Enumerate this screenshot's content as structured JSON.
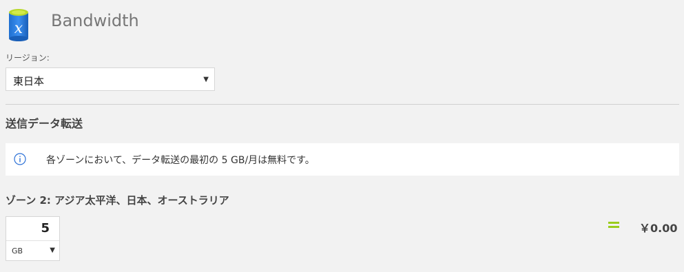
{
  "header": {
    "icon": "azure-bandwidth-icon",
    "title": "Bandwidth"
  },
  "region": {
    "label": "リージョン:",
    "selected": "東日本"
  },
  "section": {
    "title": "送信データ転送"
  },
  "info": {
    "icon": "info-icon",
    "text": "各ゾーンにおいて、データ転送の最初の 5 GB/月は無料です。"
  },
  "zone": {
    "title": "ゾーン 2: アジア太平洋、日本、オーストラリア",
    "quantity": "5",
    "unit": "GB",
    "equals_color": "#9acd1c",
    "price": "￥0.00"
  }
}
